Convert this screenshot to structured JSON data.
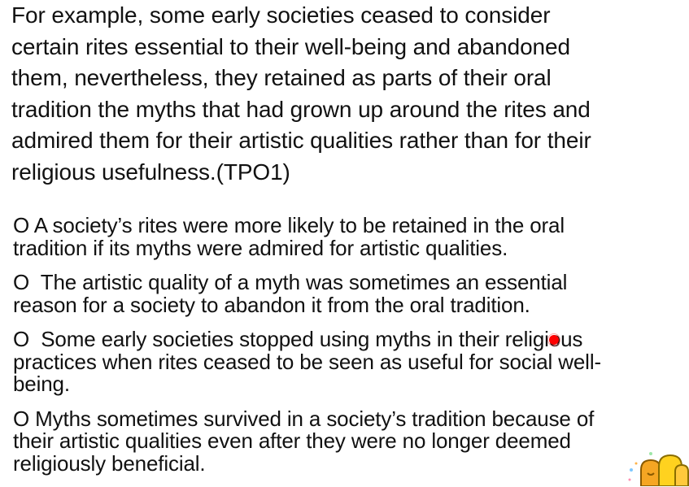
{
  "passage": {
    "lines": [
      "For example, some early societies ceased to consider",
      "certain rites essential to their well-being and abandoned",
      "them, nevertheless, they retained as parts of their oral",
      "tradition the myths that had grown up around the rites and",
      "admired them for their artistic qualities rather than for their",
      "religious usefulness.(TPO1)"
    ]
  },
  "options": [
    {
      "marker": "O",
      "lines": [
        " A society’s rites were more likely to be retained in the oral",
        "tradition if its myths were admired for artistic qualities."
      ]
    },
    {
      "marker": "O",
      "lines": [
        "  The artistic quality of a myth was sometimes an essential",
        "reason for a society to abandon it from the oral tradition."
      ]
    },
    {
      "marker": "O",
      "lines": [
        "  Some early societies stopped using myths in their religious",
        "practices when rites ceased to be seen as useful for social well-",
        "being."
      ]
    },
    {
      "marker": "O",
      "lines": [
        " Myths sometimes survived in a society’s tradition because of",
        "their artistic qualities even after they were no longer deemed",
        "religiously beneficial."
      ]
    }
  ],
  "colors": {
    "text": "#111111",
    "pointer": "#ff0000",
    "mascot_orange": "#f5a623",
    "mascot_yellow": "#ffd21f"
  }
}
